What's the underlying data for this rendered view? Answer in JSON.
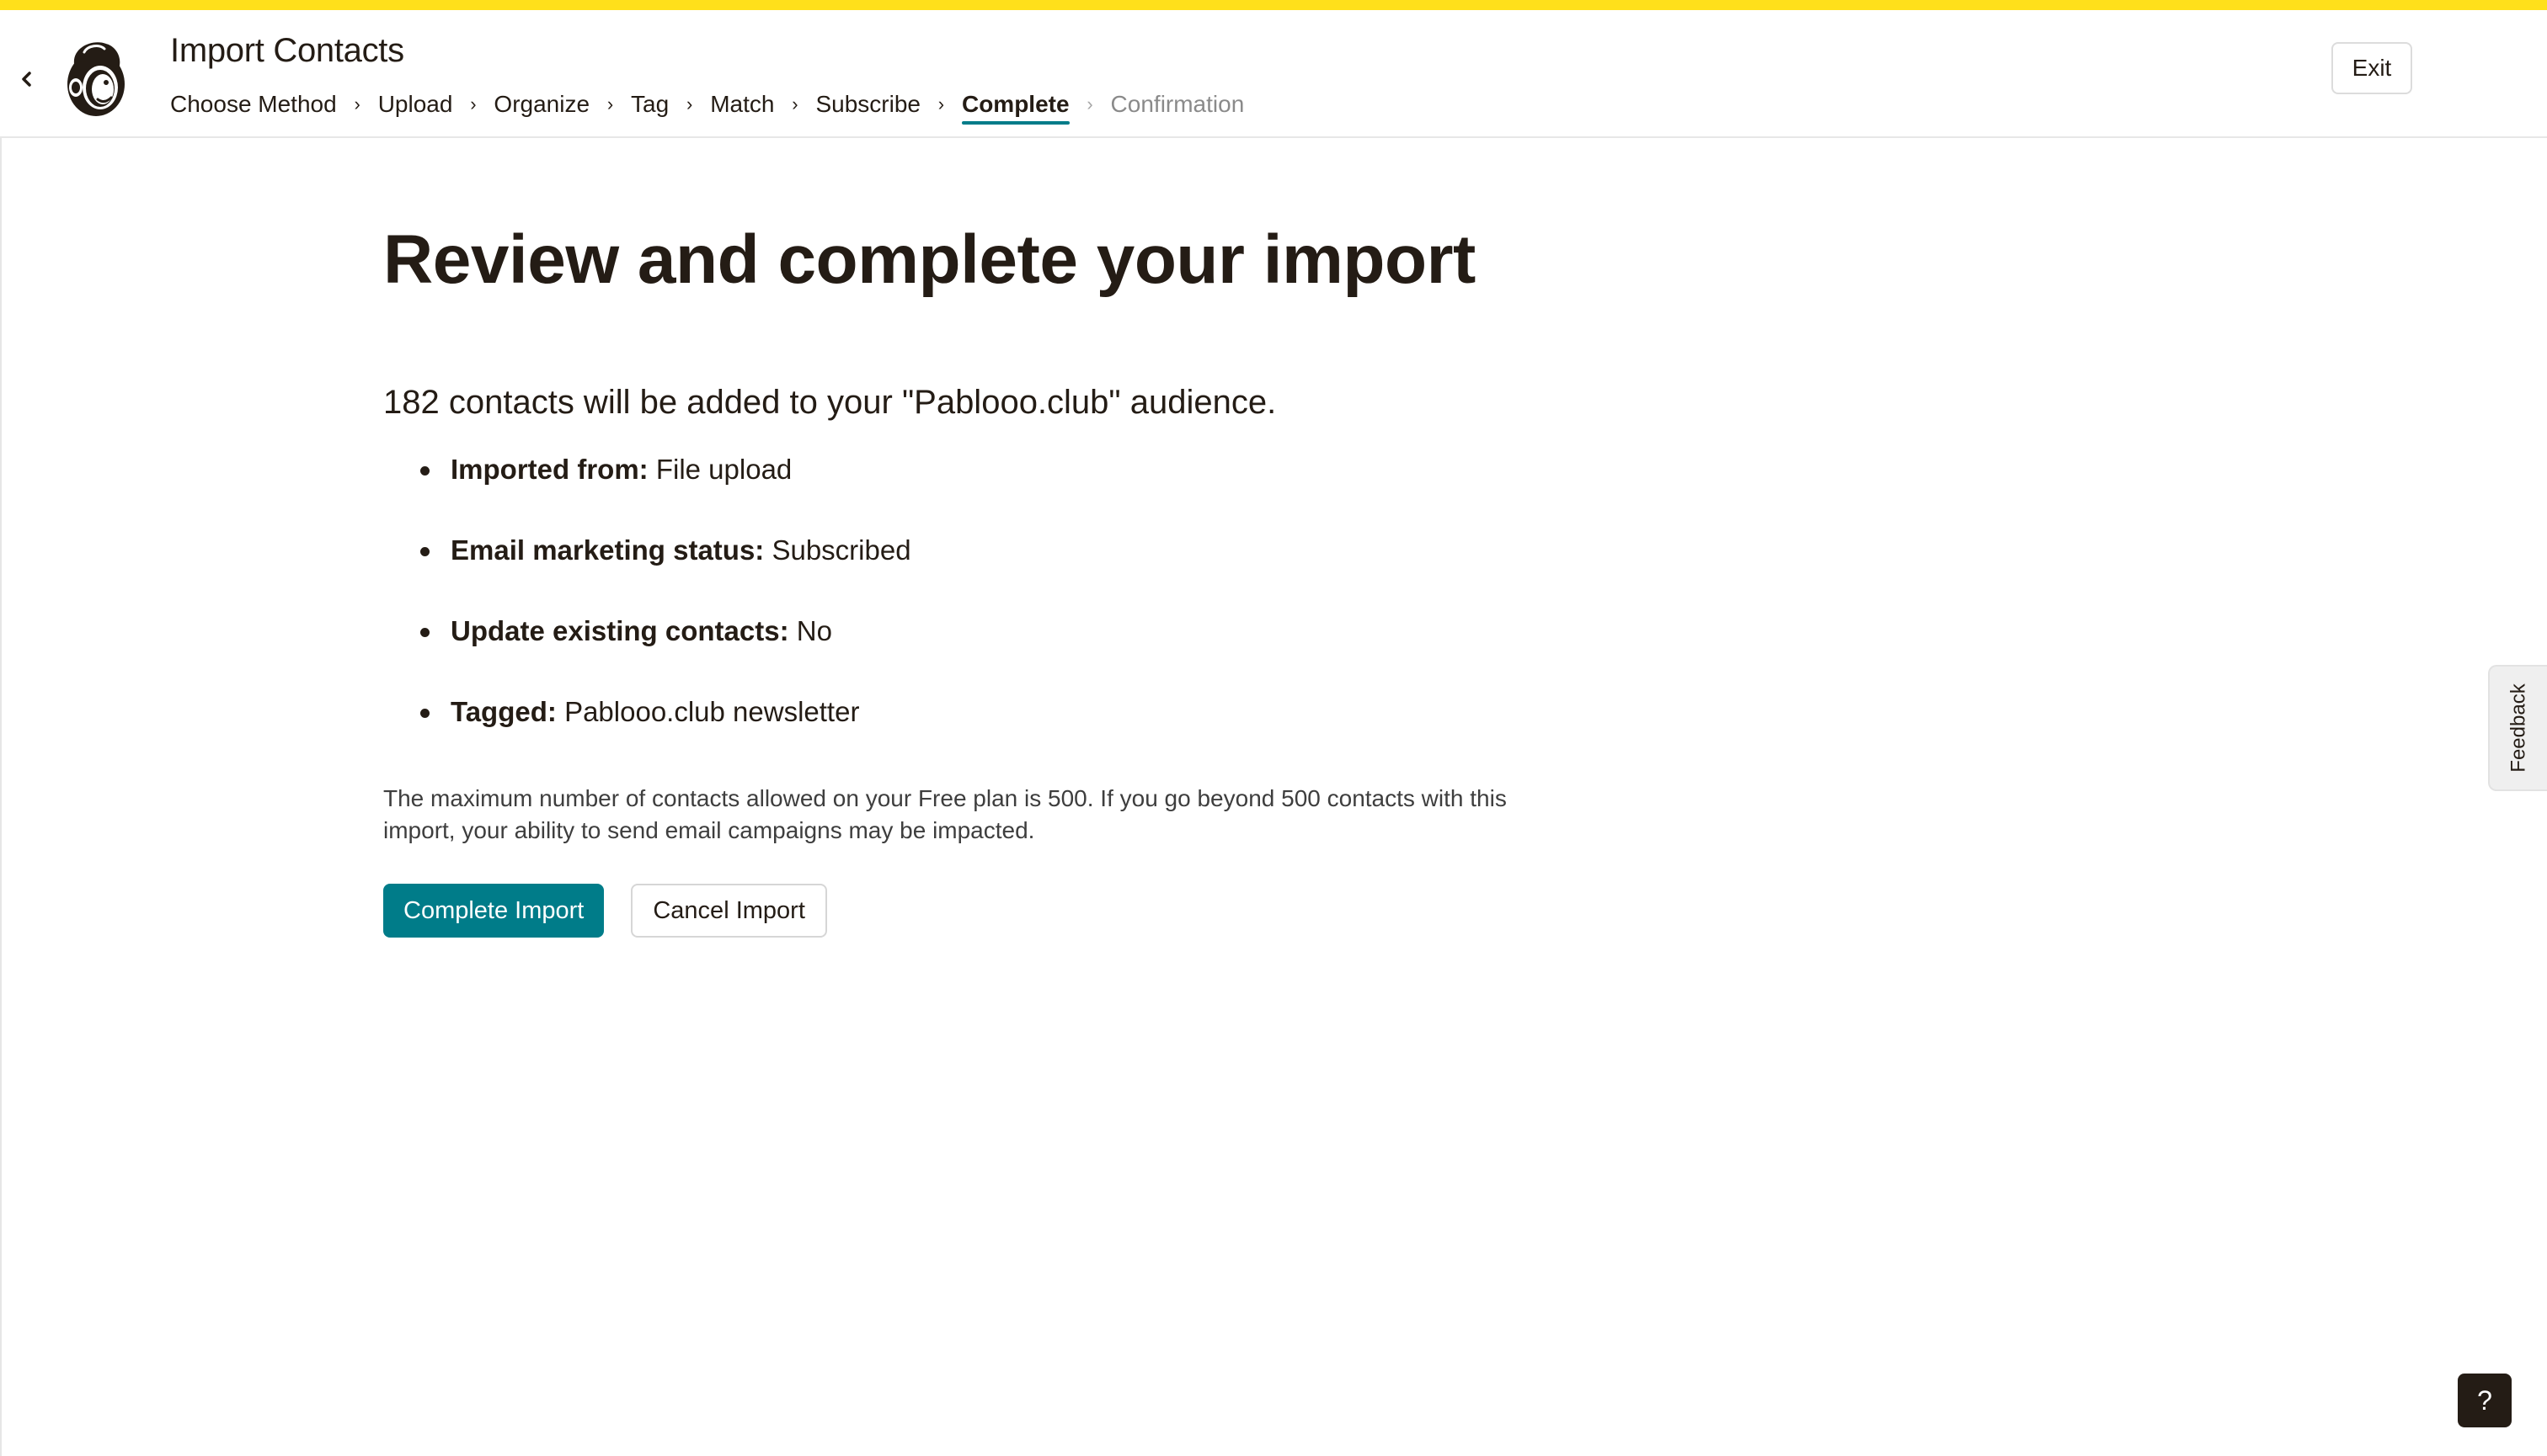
{
  "colors": {
    "accent": "#007c89",
    "stripe": "#ffe01b",
    "text": "#241c15",
    "muted": "#8a8a8a"
  },
  "header": {
    "back_icon": "chevron-left-icon",
    "logo_icon": "mailchimp-freddie-logo",
    "title": "Import Contacts",
    "steps": [
      {
        "label": "Choose Method",
        "state": "done"
      },
      {
        "label": "Upload",
        "state": "done"
      },
      {
        "label": "Organize",
        "state": "done"
      },
      {
        "label": "Tag",
        "state": "done"
      },
      {
        "label": "Match",
        "state": "done"
      },
      {
        "label": "Subscribe",
        "state": "done"
      },
      {
        "label": "Complete",
        "state": "current"
      },
      {
        "label": "Confirmation",
        "state": "future"
      }
    ],
    "step_separator": "›",
    "exit_label": "Exit"
  },
  "main": {
    "heading": "Review and complete your import",
    "summary": "182 contacts will be added to your \"Pablooo.club\" audience.",
    "details": [
      {
        "label": "Imported from:",
        "value": "File upload"
      },
      {
        "label": "Email marketing status:",
        "value": "Subscribed"
      },
      {
        "label": "Update existing contacts:",
        "value": "No"
      },
      {
        "label": "Tagged:",
        "value": "Pablooo.club newsletter"
      }
    ],
    "notice": "The maximum number of contacts allowed on your Free plan is 500. If you go beyond 500 contacts with this import, your ability to send email campaigns may be impacted.",
    "complete_label": "Complete Import",
    "cancel_label": "Cancel Import"
  },
  "feedback_label": "Feedback",
  "help_label": "?"
}
